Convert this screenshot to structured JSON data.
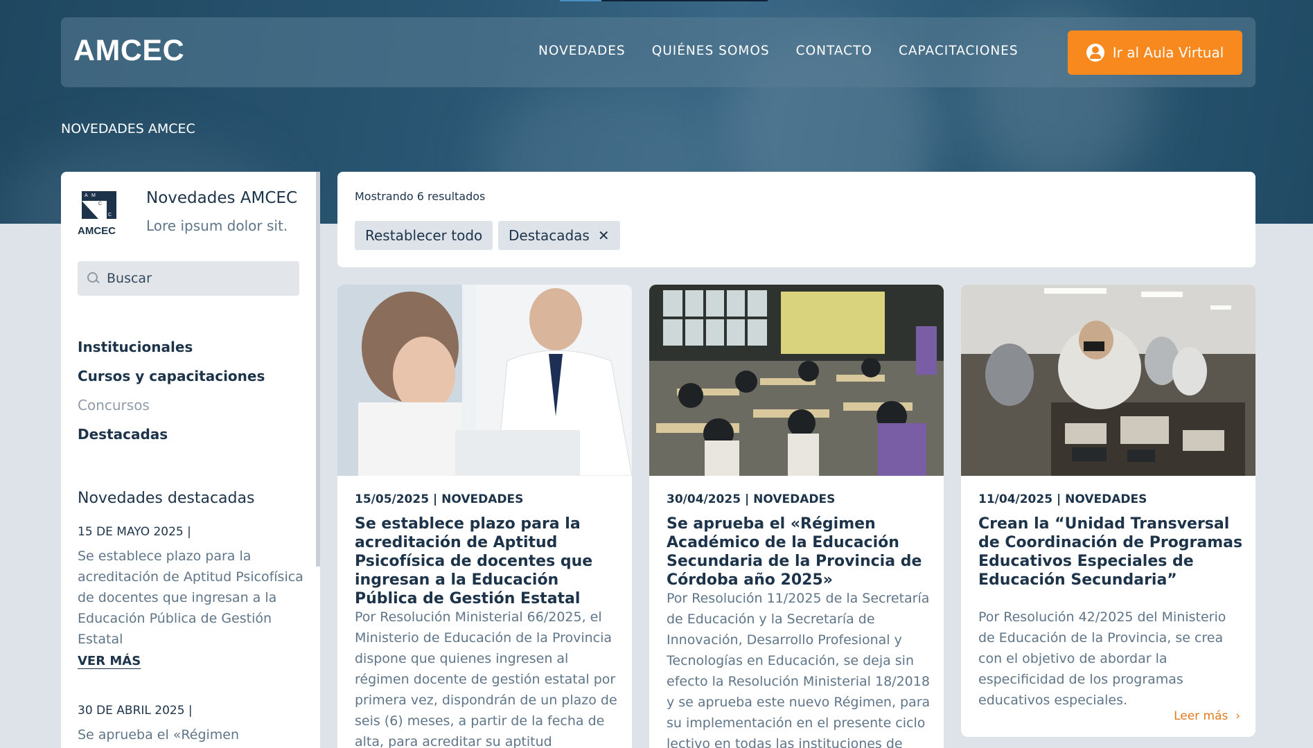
{
  "header": {
    "logo": "AMCEC",
    "nav": [
      "NOVEDADES",
      "QUIÉNES SOMOS",
      "CONTACTO",
      "CAPACITACIONES"
    ],
    "cta_label": "Ir al Aula Virtual"
  },
  "breadcrumb": "NOVEDADES AMCEC",
  "sidebar": {
    "brand_mark_text": "AMCEC",
    "brand_title": "Novedades AMCEC",
    "brand_subtitle": "Lore ipsum dolor sit.",
    "search_placeholder": "Buscar",
    "categories": [
      "Institucionales",
      "Cursos y capacitaciones",
      "Concursos",
      "Destacadas"
    ],
    "featured_title": "Novedades destacadas",
    "featured": [
      {
        "date": "15 DE MAYO 2025  |",
        "text": "Se establece plazo para la acreditación de Aptitud Psicofísica de docentes que ingresan a la Educación Pública de Gestión Estatal",
        "more": "VER MÁS"
      },
      {
        "date": "30 DE ABRIL 2025  |",
        "text": "Se aprueba el «Régimen Académico"
      }
    ]
  },
  "results": {
    "count": "Mostrando 6 resultados",
    "reset": "Restablecer todo",
    "filter": "Destacadas"
  },
  "cards": [
    {
      "meta": "15/05/2025  |  NOVEDADES",
      "title": "Se establece plazo para la acreditación de Aptitud Psicofísica de docentes que ingresan a la Educación Pública de Gestión Estatal",
      "excerpt": "Por Resolución Ministerial 66/2025, el Ministerio de Educación de la Provincia dispone que quienes ingresen al régimen docente de gestión estatal por primera vez, dispondrán de un plazo de seis (6) meses, a partir de la fecha de alta, para acreditar su aptitud psicofísica."
    },
    {
      "meta": "30/04/2025  |  NOVEDADES",
      "title": "Se aprueba el «Régimen Académico de la Educación Secundaria de la Provincia de Córdoba año 2025»",
      "excerpt": "Por Resolución 11/2025 de la Secretaría de Educación y la Secretaría de Innovación, Desarrollo Profesional y Tecnologías en Educación, se deja sin efecto la Resolución Ministerial 18/2018 y se aprueba este nuevo Régimen, para su implementación en el presente ciclo lectivo en todas las instituciones de"
    },
    {
      "meta": "11/04/2025  |  NOVEDADES",
      "title": "Crean la “Unidad Transversal de Coordinación de Programas Educativos Especiales de Educación Secundaria”",
      "excerpt": "Por Resolución 42/2025 del Ministerio de Educación de la Provincia, se crea con el objetivo de abordar la especificidad de los programas educativos especiales.",
      "more": "Leer más"
    }
  ]
}
